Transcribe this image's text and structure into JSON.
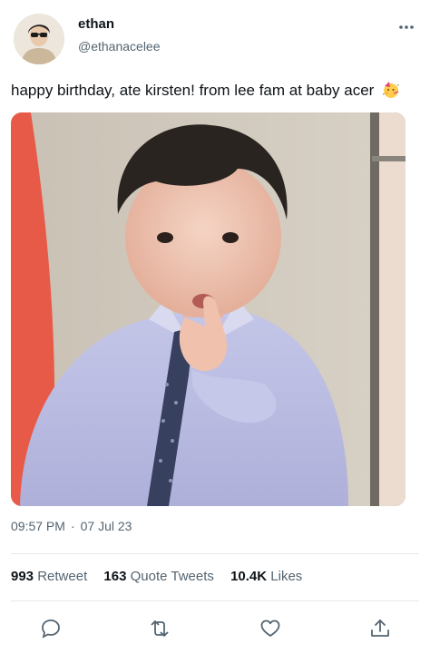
{
  "user": {
    "display_name": "ethan",
    "handle": "@ethanacelee"
  },
  "tweet": {
    "text": "happy birthday, ate kirsten! from lee fam at baby acer",
    "emoji": "partying-face"
  },
  "meta": {
    "time": "09:57 PM",
    "separator": "·",
    "date": "07 Jul 23"
  },
  "stats": {
    "retweets_count": "993",
    "retweets_label": "Retweet",
    "quotes_count": "163",
    "quotes_label": "Quote Tweets",
    "likes_count": "10.4K",
    "likes_label": "Likes"
  },
  "actions": [
    "reply-icon",
    "retweet-icon",
    "like-icon",
    "share-icon"
  ],
  "colors": {
    "text": "#0f1419",
    "muted": "#536471",
    "divider": "#e6e9ec"
  }
}
